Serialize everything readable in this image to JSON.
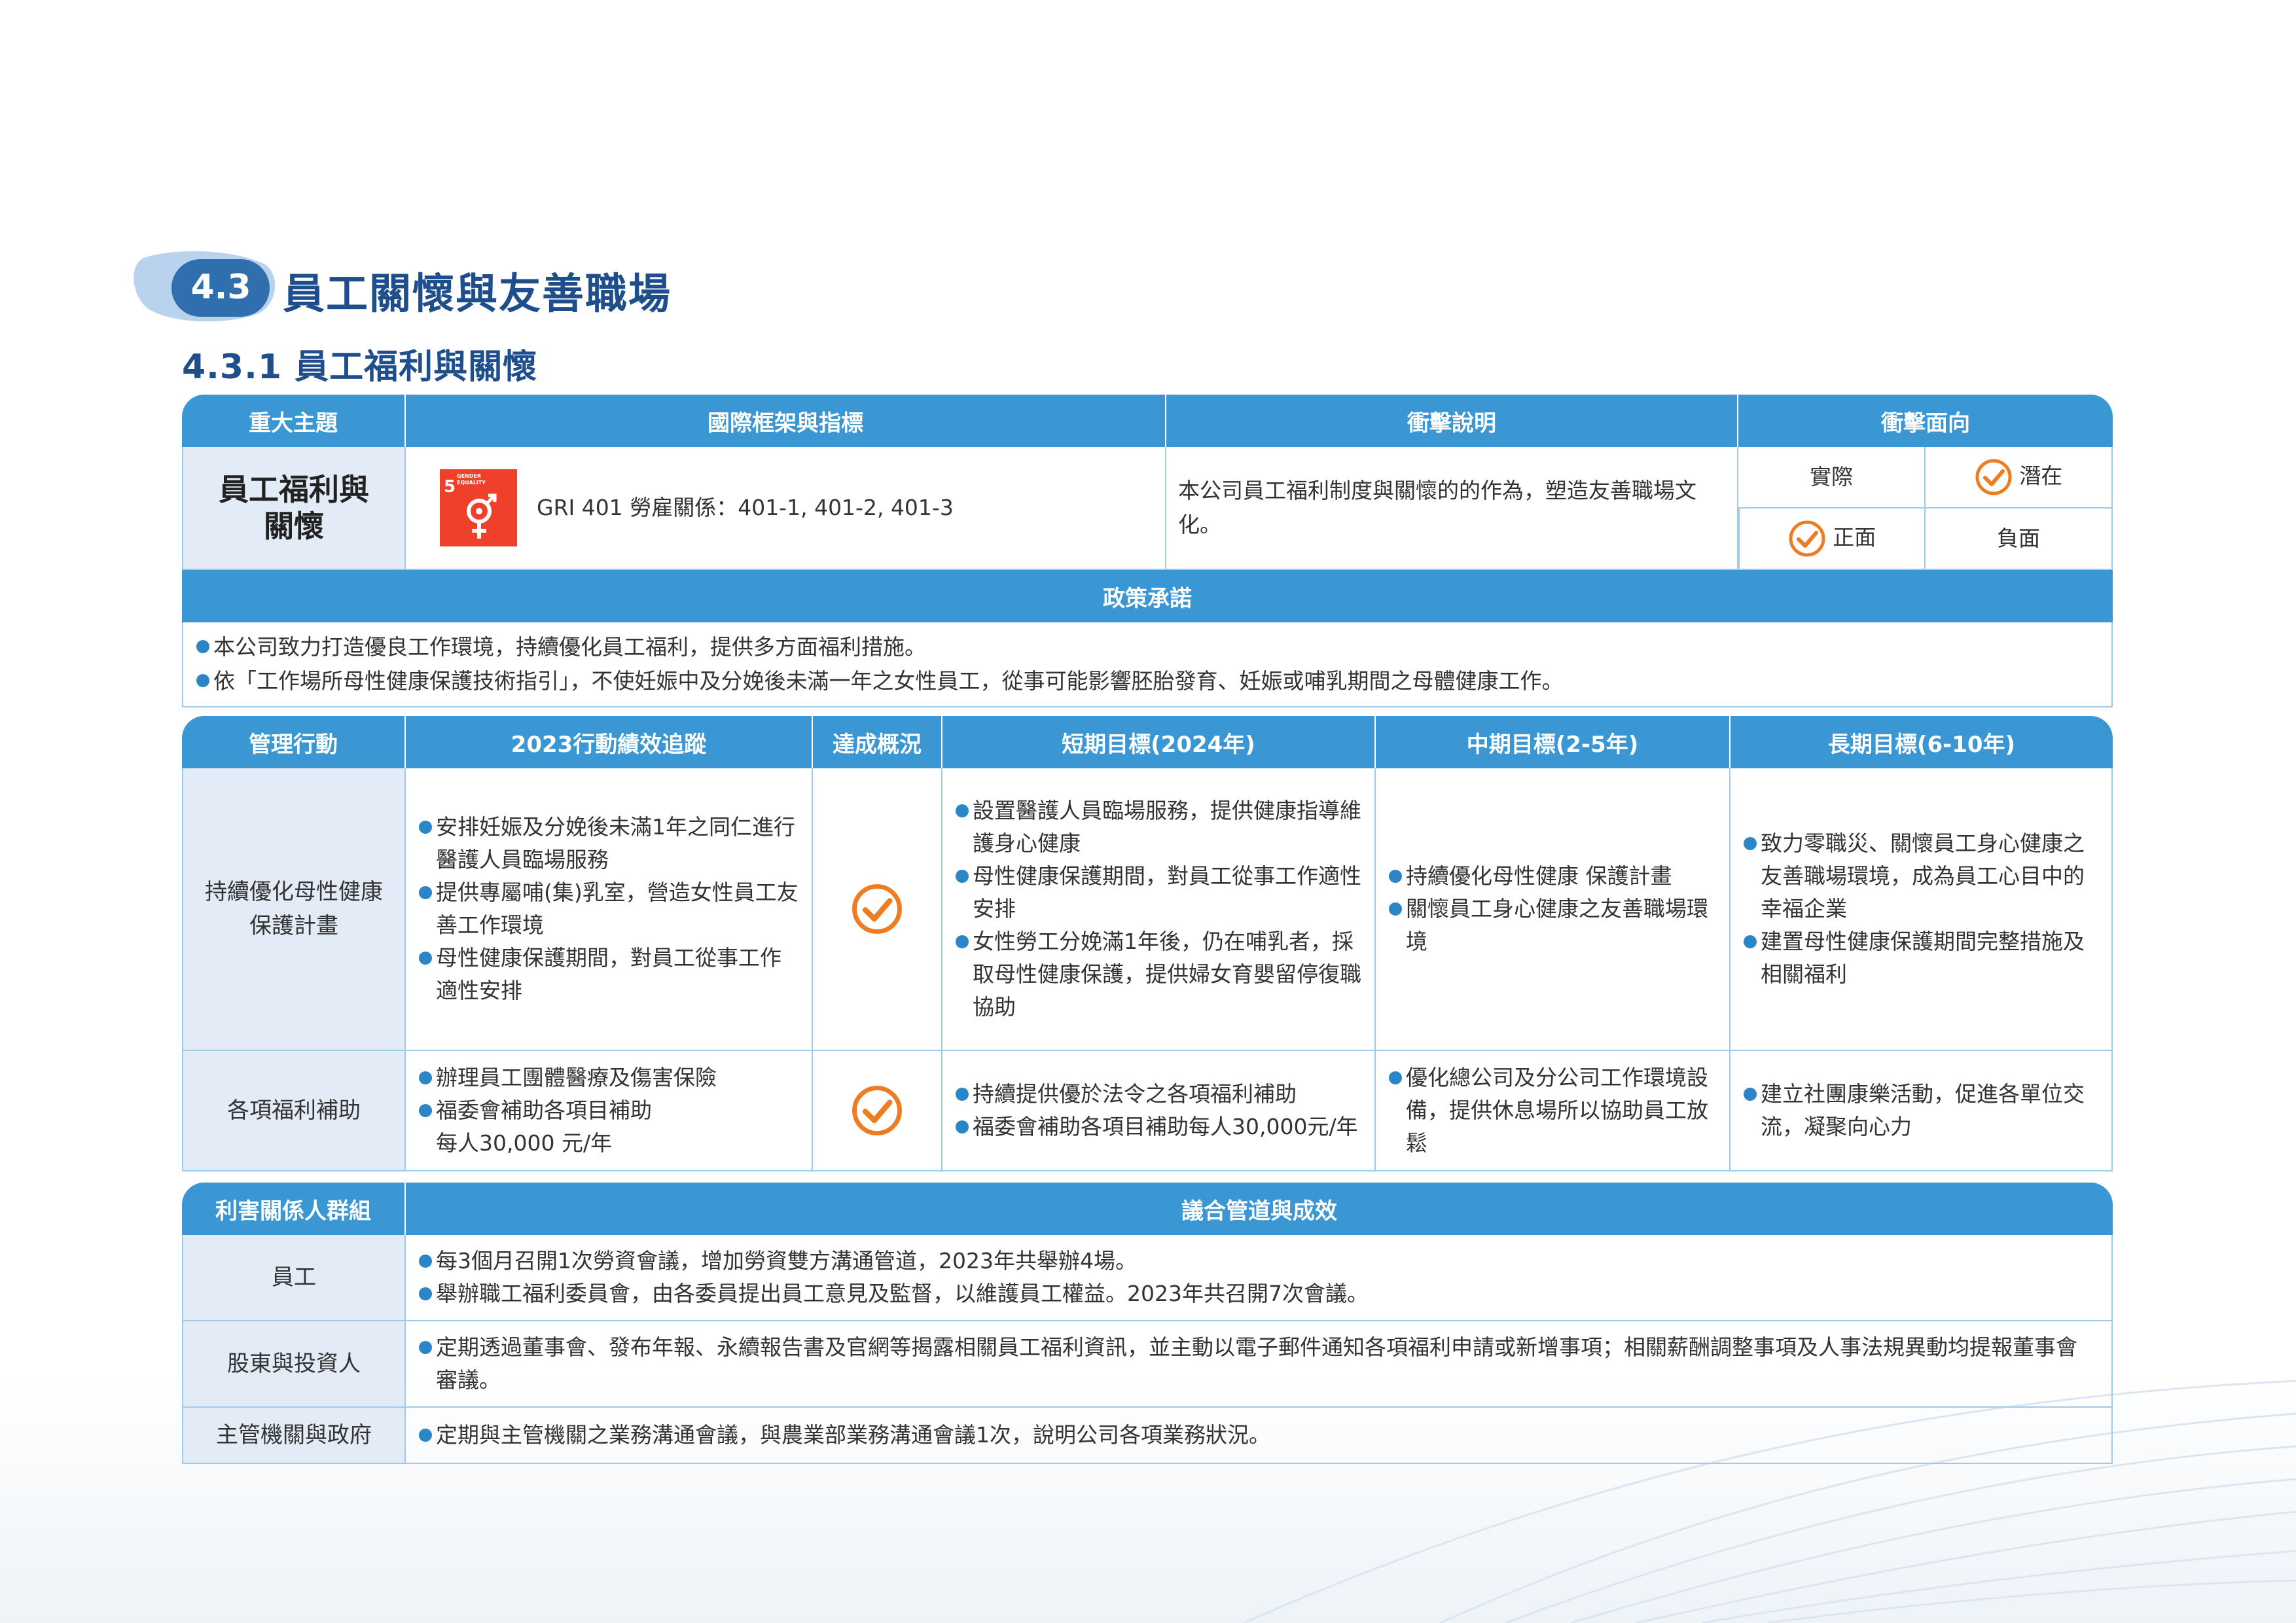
{
  "section": {
    "number": "4.3",
    "title": "員工關懷與友善職場"
  },
  "subsection": {
    "title": "4.3.1 員工福利與關懷"
  },
  "topic_table": {
    "headers": [
      "重大主題",
      "國際框架與指標",
      "衝擊說明",
      "衝擊面向"
    ],
    "topic": "員工福利與\n關懷",
    "sdg": {
      "number": "5",
      "label": "GENDER EQUALITY",
      "icon": "gender-equality-icon",
      "color": "#ef402b"
    },
    "framework": "GRI 401 勞雇關係：401-1, 401-2, 401-3",
    "impact_description": "本公司員工福利制度與關懷的的作為，塑造友善職場文化。",
    "impact_aspects": {
      "actual": "實際",
      "potential": "潛在",
      "positive": "正面",
      "negative": "負面",
      "checked": [
        "potential",
        "positive"
      ]
    },
    "policy_header": "政策承諾",
    "policy_items": [
      "本公司致力打造優良工作環境，持續優化員工福利，提供多方面福利措施。",
      "依「工作場所母性健康保護技術指引」，不使妊娠中及分娩後未滿一年之女性員工，從事可能影響胚胎發育、妊娠或哺乳期間之母體健康工作。"
    ]
  },
  "action_table": {
    "headers": [
      "管理行動",
      "2023行動績效追蹤",
      "達成概況",
      "短期目標(2024年)",
      "中期目標(2-5年)",
      "長期目標(6-10年)"
    ],
    "rows": [
      {
        "action": "持續優化母性健康\n保護計畫",
        "tracking": [
          "安排妊娠及分娩後未滿1年之同仁進行醫護人員臨場服務",
          "提供專屬哺(集)乳室，營造女性員工友善工作環境",
          "母性健康保護期間，對員工從事工作適性安排"
        ],
        "achieved": true,
        "short_term": [
          "設置醫護人員臨場服務，提供健康指導維護身心健康",
          "母性健康保護期間，對員工從事工作適性安排",
          "女性勞工分娩滿1年後，仍在哺乳者，採取母性健康保護，提供婦女育嬰留停復職協助"
        ],
        "mid_term": [
          "持續優化母性健康 保護計畫",
          "關懷員工身心健康之友善職場環境"
        ],
        "long_term": [
          "致力零職災、關懷員工身心健康之友善職場環境，成為員工心目中的幸福企業",
          "建置母性健康保護期間完整措施及相關福利"
        ]
      },
      {
        "action": "各項福利補助",
        "tracking": [
          "辦理員工團體醫療及傷害保險",
          "福委會補助各項目補助\n每人30,000 元/年"
        ],
        "achieved": true,
        "short_term": [
          "持續提供優於法令之各項福利補助",
          "福委會補助各項目補助每人30,000元/年"
        ],
        "mid_term": [
          "優化總公司及分公司工作環境設備，提供休息場所以協助員工放鬆"
        ],
        "long_term": [
          "建立社團康樂活動，促進各單位交流，凝聚向心力"
        ]
      }
    ]
  },
  "stakeholder_table": {
    "headers": [
      "利害關係人群組",
      "議合管道與成效"
    ],
    "rows": [
      {
        "group": "員工",
        "items": [
          "每3個月召開1次勞資會議，增加勞資雙方溝通管道，2023年共舉辦4場。",
          "舉辦職工福利委員會，由各委員提出員工意見及監督，以維護員工權益。2023年共召開7次會議。"
        ]
      },
      {
        "group": "股東與投資人",
        "items": [
          "定期透過董事會、發布年報、永續報告書及官網等揭露相關員工福利資訊，並主動以電子郵件通知各項福利申請或新增事項；相關薪酬調整事項及人事法規異動均提報董事會審議。"
        ]
      },
      {
        "group": "主管機關與政府",
        "items": [
          "定期與主管機關之業務溝通會議，與農業部業務溝通會議1次，說明公司各項業務狀況。"
        ]
      }
    ]
  },
  "colors": {
    "header_blue": "#3b97d3",
    "title_blue": "#1e4e8c",
    "pale_blue": "#e3ebf6",
    "check_orange": "#ee7d22",
    "sdg_red": "#ef402b"
  }
}
